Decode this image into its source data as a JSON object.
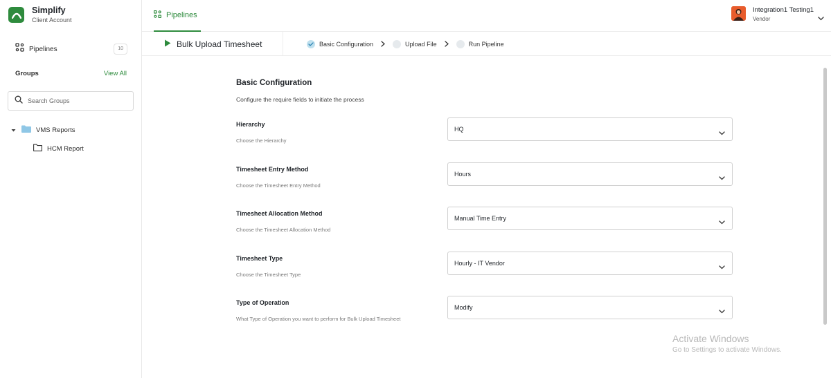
{
  "brand": {
    "name": "Simplify",
    "subtitle": "Client Account"
  },
  "sidebar": {
    "pipelines_label": "Pipelines",
    "pipelines_count": "10",
    "groups_title": "Groups",
    "view_all_label": "View All",
    "search_placeholder": "Search Groups",
    "tree": [
      {
        "label": "VMS Reports",
        "icon": "folder-filled-icon",
        "expanded": true
      },
      {
        "label": "HCM Report",
        "icon": "folder-outline-icon"
      }
    ]
  },
  "topbar": {
    "tab_label": "Pipelines",
    "user_name": "Integration1 Testing1",
    "user_role": "Vendor"
  },
  "pipeline": {
    "title": "Bulk Upload Timesheet",
    "steps": [
      {
        "label": "Basic Configuration",
        "state": "current"
      },
      {
        "label": "Upload File",
        "state": "pending"
      },
      {
        "label": "Run Pipeline",
        "state": "pending"
      }
    ]
  },
  "form": {
    "title": "Basic Configuration",
    "subtitle": "Configure the require fields to initiate the process",
    "fields": [
      {
        "label": "Hierarchy",
        "help": "Choose the Hierarchy",
        "value": "HQ"
      },
      {
        "label": "Timesheet Entry Method",
        "help": "Choose the Timesheet Entry Method",
        "value": "Hours"
      },
      {
        "label": "Timesheet Allocation Method",
        "help": "Choose the Timesheet Allocation Method",
        "value": "Manual Time Entry"
      },
      {
        "label": "Timesheet Type",
        "help": "Choose the Timesheet Type",
        "value": "Hourly - IT Vendor"
      },
      {
        "label": "Type of Operation",
        "help": "What Type of Operation you want to perform for Bulk Upload Timesheet",
        "value": "Modify"
      }
    ]
  },
  "watermark": {
    "title": "Activate Windows",
    "subtitle": "Go to Settings to activate Windows."
  },
  "colors": {
    "accent": "#2e8b3d",
    "step_done": "#bfe0ee",
    "avatar": "#e85c2c"
  }
}
